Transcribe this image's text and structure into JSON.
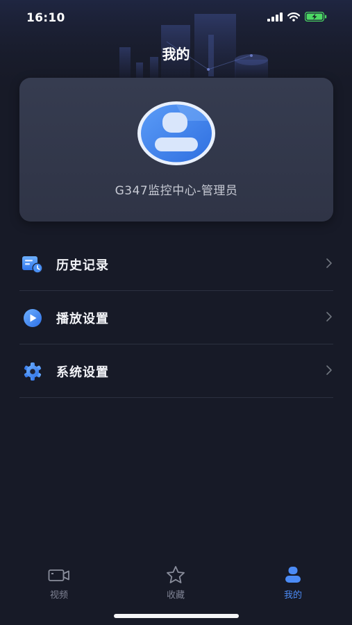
{
  "status_bar": {
    "time": "16:10"
  },
  "header": {
    "title": "我的"
  },
  "profile": {
    "name": "G347监控中心-管理员"
  },
  "menu": {
    "items": [
      {
        "label": "历史记录",
        "icon": "history-record-icon"
      },
      {
        "label": "播放设置",
        "icon": "play-icon"
      },
      {
        "label": "系统设置",
        "icon": "gear-icon"
      }
    ]
  },
  "tabs": [
    {
      "label": "视频",
      "icon": "video-camera-icon",
      "active": false
    },
    {
      "label": "收藏",
      "icon": "star-icon",
      "active": false
    },
    {
      "label": "我的",
      "icon": "user-icon",
      "active": true
    }
  ],
  "colors": {
    "background": "#171a27",
    "card": "#343a4d",
    "accent": "#4c8bf5",
    "inactive_tab": "#7f8394",
    "battery": "#4cd964"
  }
}
